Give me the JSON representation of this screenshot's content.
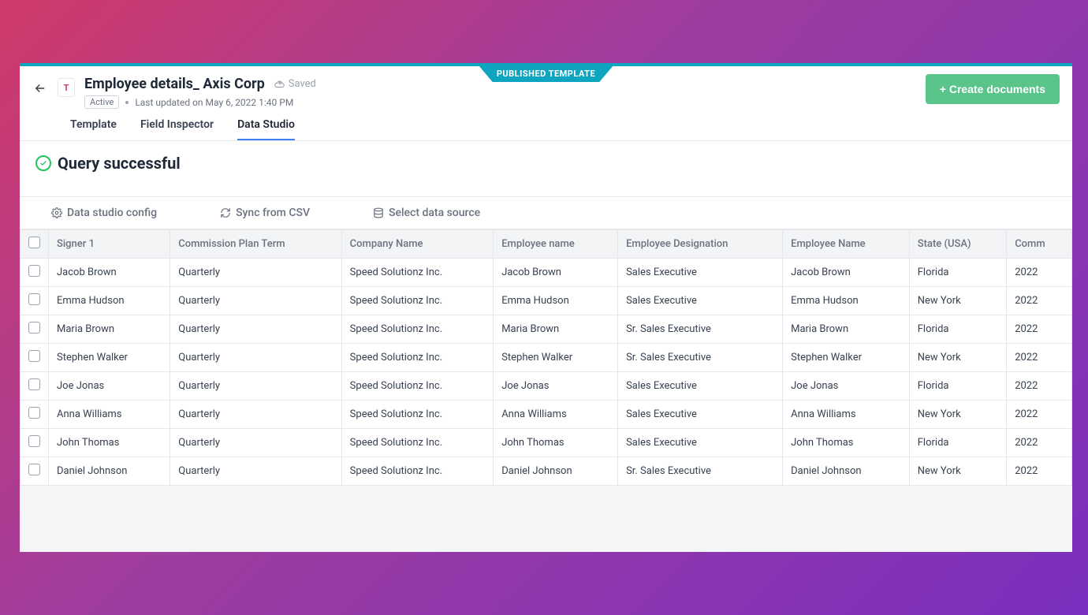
{
  "header": {
    "badge": "PUBLISHED TEMPLATE",
    "doc_letter": "T",
    "title": "Employee details_ Axis Corp",
    "saved": "Saved",
    "active": "Active",
    "last_updated": "Last updated on May 6, 2022 1:40 PM",
    "create_btn": "+ Create documents",
    "tabs": [
      "Template",
      "Field Inspector",
      "Data Studio"
    ],
    "active_tab": 2
  },
  "status": {
    "text": "Query successful"
  },
  "toolbar": {
    "config": "Data studio config",
    "sync": "Sync from CSV",
    "select_source": "Select data source"
  },
  "table": {
    "columns": [
      "Signer 1",
      "Commission Plan Term",
      "Company Name",
      "Employee name",
      "Employee Designation",
      "Employee Name",
      "State (USA)",
      "Comm"
    ],
    "rows": [
      [
        "Jacob Brown",
        "Quarterly",
        "Speed Solutionz Inc.",
        "Jacob Brown",
        "Sales Executive",
        "Jacob Brown",
        "Florida",
        "2022"
      ],
      [
        "Emma Hudson",
        "Quarterly",
        "Speed Solutionz Inc.",
        "Emma Hudson",
        "Sales Executive",
        "Emma Hudson",
        "New York",
        "2022"
      ],
      [
        "Maria Brown",
        "Quarterly",
        "Speed Solutionz Inc.",
        "Maria Brown",
        "Sr. Sales Executive",
        "Maria Brown",
        "Florida",
        "2022"
      ],
      [
        "Stephen Walker",
        "Quarterly",
        "Speed Solutionz Inc.",
        "Stephen Walker",
        "Sr. Sales Executive",
        "Stephen Walker",
        "New York",
        "2022"
      ],
      [
        "Joe Jonas",
        "Quarterly",
        "Speed Solutionz Inc.",
        "Joe Jonas",
        "Sales Executive",
        "Joe Jonas",
        "Florida",
        "2022"
      ],
      [
        "Anna Williams",
        "Quarterly",
        "Speed Solutionz Inc.",
        "Anna Williams",
        "Sales Executive",
        "Anna Williams",
        "New York",
        "2022"
      ],
      [
        "John Thomas",
        "Quarterly",
        "Speed Solutionz Inc.",
        "John Thomas",
        "Sales Executive",
        "John Thomas",
        "Florida",
        "2022"
      ],
      [
        "Daniel Johnson",
        "Quarterly",
        "Speed Solutionz Inc.",
        "Daniel Johnson",
        "Sr. Sales Executive",
        "Daniel Johnson",
        "New York",
        "2022"
      ]
    ]
  }
}
